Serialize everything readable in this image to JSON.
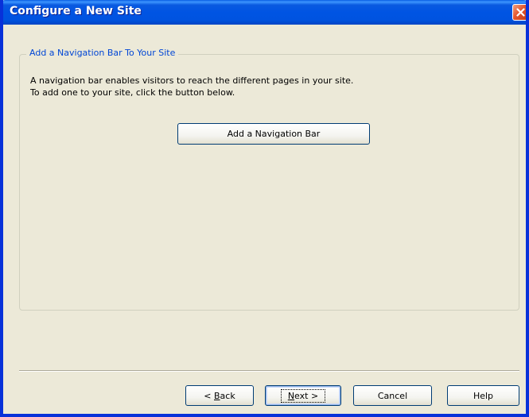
{
  "window": {
    "title": "Configure a New Site"
  },
  "group": {
    "legend": "Add a Navigation Bar To Your Site",
    "description_line1": "A navigation bar enables visitors to reach the different pages in your site.",
    "description_line2": "To add one to your site, click the button below.",
    "add_button_label": "Add a Navigation Bar"
  },
  "footer": {
    "back": {
      "prefix": "< ",
      "mnemonic": "B",
      "rest": "ack"
    },
    "next": {
      "mnemonic": "N",
      "rest": "ext >"
    },
    "cancel": "Cancel",
    "help": "Help"
  },
  "icons": {
    "close": "close-icon"
  },
  "colors": {
    "titlebar": "#0054e3",
    "dialog_background": "#ece9d8",
    "legend_text": "#0046d5",
    "close_button": "#e3562e"
  }
}
